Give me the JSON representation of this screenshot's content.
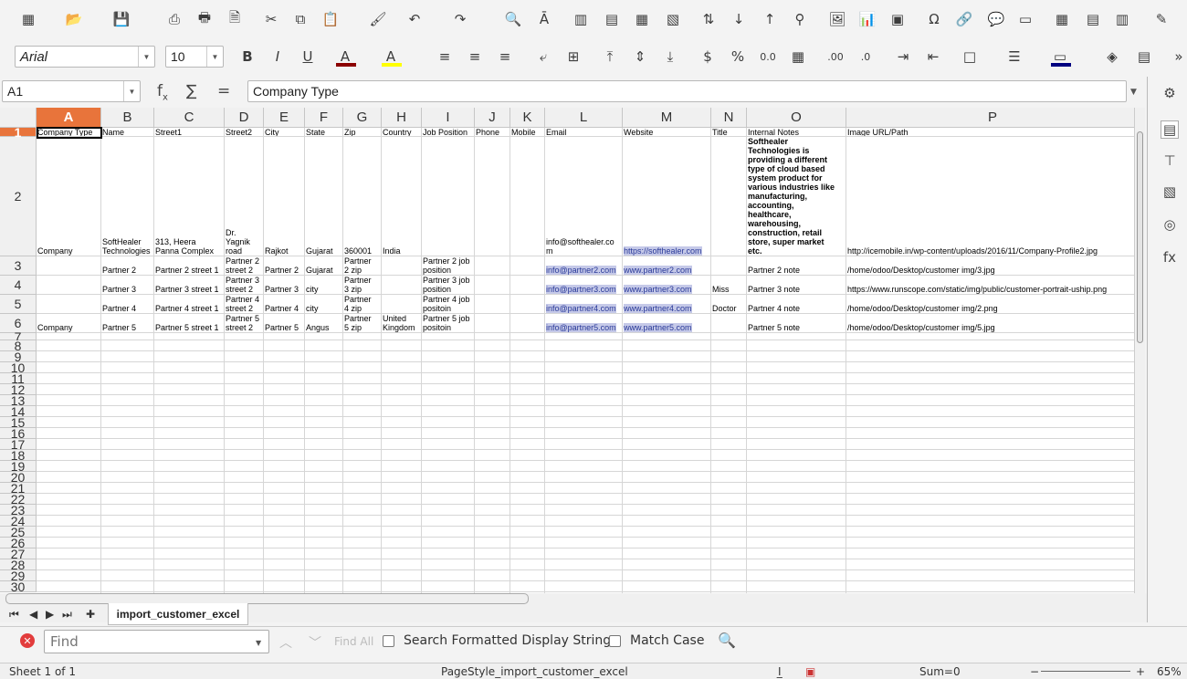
{
  "toolbar1": {
    "icons": [
      "spreadsheet-new-icon",
      "open-icon",
      "save-icon",
      "export-pdf-icon",
      "print-icon",
      "print-preview-icon",
      "cut-icon",
      "copy-icon",
      "paste-icon",
      "clone-formatting-icon",
      "undo-icon",
      "redo-icon",
      "find-replace-icon",
      "spelling-icon",
      "row-icon",
      "column-icon",
      "delete-row-icon",
      "delete-column-icon",
      "sort-icon",
      "sort-ascending-icon",
      "sort-descending-icon",
      "autofilter-icon",
      "image-icon",
      "chart-icon",
      "pivot-table-icon",
      "special-character-icon",
      "hyperlink-icon",
      "comment-icon",
      "headers-footers-icon",
      "define-print-area-icon",
      "freeze-icon",
      "split-window-icon",
      "show-draw-functions-icon"
    ]
  },
  "toolbar2": {
    "font_name": "Arial",
    "font_size": "10",
    "font_color": "#8b0000",
    "highlight_color": "#ffff00",
    "border_color": "#000080"
  },
  "formula_bar": {
    "cell_ref": "A1",
    "content": "Company Type"
  },
  "columns": [
    "A",
    "B",
    "C",
    "D",
    "E",
    "F",
    "G",
    "H",
    "I",
    "J",
    "K",
    "L",
    "M",
    "N",
    "O",
    "P"
  ],
  "rows": [
    "1",
    "2",
    "3",
    "4",
    "5",
    "6",
    "7",
    "8",
    "9",
    "10",
    "11",
    "12",
    "13",
    "14",
    "15",
    "16",
    "17",
    "18",
    "19",
    "20",
    "21",
    "22",
    "23",
    "24",
    "25",
    "26",
    "27",
    "28",
    "29",
    "30"
  ],
  "table": {
    "headers": [
      "Company Type",
      "Name",
      "Street1",
      "Street2",
      "City",
      "State",
      "Zip",
      "Country",
      "Job Position",
      "Phone",
      "Mobile",
      "Email",
      "Website",
      "Title",
      "Internal Notes",
      "Image URL/Path"
    ],
    "row2": [
      "Company",
      "SoftHealer\nTechnologies",
      "313, Heera\nPanna Complex",
      "Dr.\nYagnik\nroad",
      "Rajkot",
      "Gujarat",
      "360001",
      "India",
      "",
      "",
      "",
      "info@softhealer.co\nm",
      "https://softhealer.com",
      "",
      "Softhealer\nTechnologies is\nproviding a different\ntype of cloud based\nsystem product for\nvarious industries like\nmanufacturing,\naccounting,\nhealthcare,\nwarehousing,\nconstruction, retail\nstore, super market\netc.",
      "http://icemobile.in/wp-content/uploads/2016/11/Company-Profile2.jpg"
    ],
    "row3": [
      "",
      "Partner 2",
      "Partner 2 street 1",
      "Partner 2\nstreet 2",
      "Partner 2",
      "Gujarat",
      "Partner\n2 zip",
      "",
      "Partner 2 job\nposition",
      "",
      "",
      "info@partner2.com",
      "www.partner2.com",
      "",
      "Partner 2 note",
      "/home/odoo/Desktop/customer img/3.jpg"
    ],
    "row4": [
      "",
      "Partner 3",
      "Partner 3 street 1",
      "Partner 3\nstreet 2",
      "Partner 3",
      "city",
      "Partner\n3 zip",
      "",
      "Partner 3 job\nposition",
      "",
      "",
      "info@partner3.com",
      "www.partner3.com",
      "Miss",
      "Partner 3 note",
      "https://www.runscope.com/static/img/public/customer-portrait-uship.png"
    ],
    "row5": [
      "",
      "Partner 4",
      "Partner 4 street 1",
      "Partner 4\nstreet 2",
      "Partner 4",
      "city",
      "Partner\n4 zip",
      "",
      "Partner 4 job\npositoin",
      "",
      "",
      "info@partner4.com",
      "www.partner4.com",
      "Doctor",
      "Partner 4 note",
      "/home/odoo/Desktop/customer img/2.png"
    ],
    "row6": [
      "Company",
      "Partner 5",
      "Partner 5 street 1",
      "Partner 5\nstreet 2",
      "Partner 5",
      "Angus",
      "Partner\n5 zip",
      "United\nKingdom",
      "Partner 5 job\npositoin",
      "",
      "",
      "info@partner5.com",
      "www.partner5.com",
      "",
      "Partner 5 note",
      "/home/odoo/Desktop/customer img/5.jpg"
    ]
  },
  "sheet_tab": "import_customer_excel",
  "find_bar": {
    "placeholder": "Find",
    "find_all": "Find All",
    "search_formatted": "Search Formatted Display String",
    "match_case": "Match Case"
  },
  "status_bar": {
    "sheet": "Sheet 1 of 1",
    "page_style": "PageStyle_import_customer_excel",
    "sum": "Sum=0",
    "zoom": "65%"
  },
  "colors": {
    "selection": "#e8743b",
    "link_bg": "#c5c9e8"
  }
}
